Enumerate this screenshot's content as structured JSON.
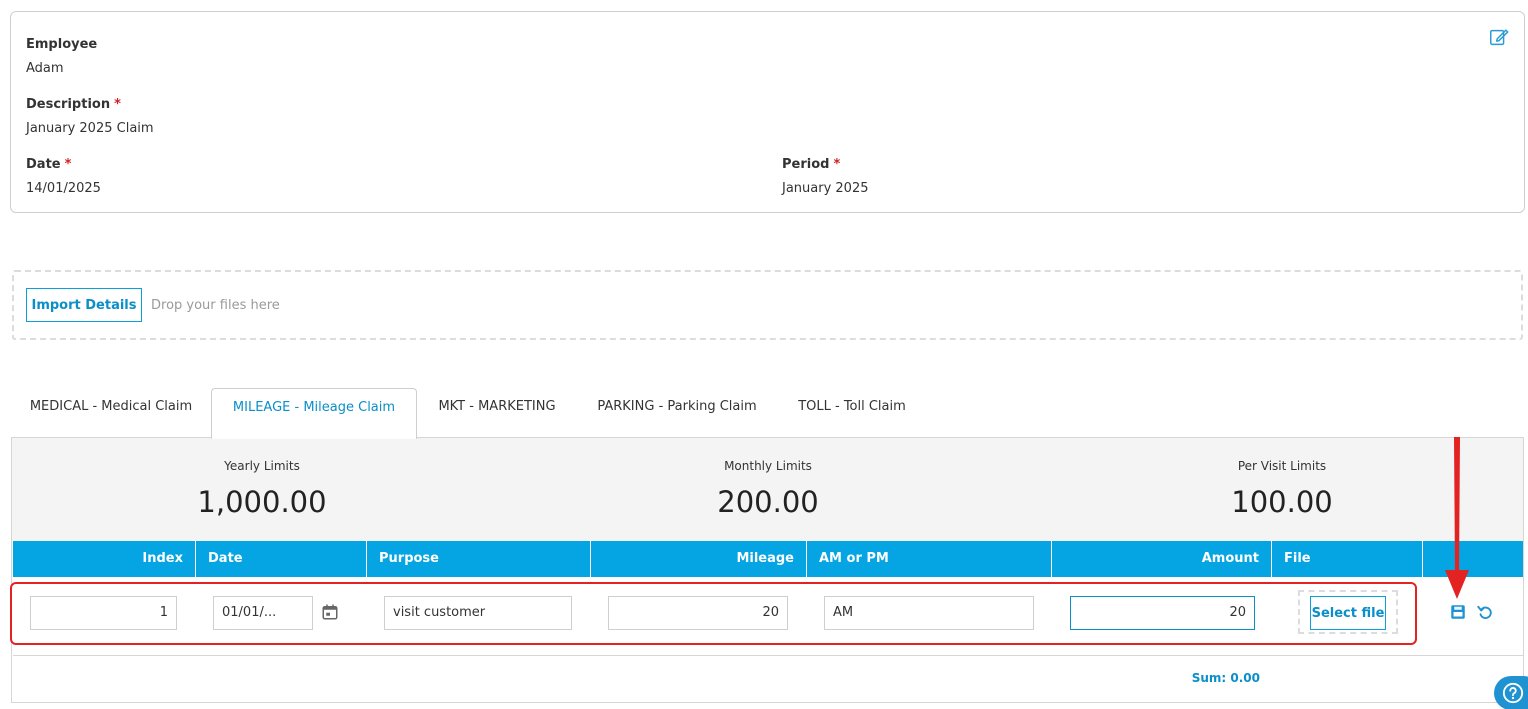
{
  "header": {
    "employee_label": "Employee",
    "employee_value": "Adam",
    "description_label": "Description",
    "description_value": "January 2025 Claim",
    "date_label": "Date",
    "date_value": "14/01/2025",
    "period_label": "Period",
    "period_value": "January 2025",
    "required_mark": "*"
  },
  "dropzone": {
    "import_label": "Import Details",
    "drop_text": "Drop your files here"
  },
  "tabs": [
    {
      "label": "MEDICAL - Medical Claim",
      "active": false
    },
    {
      "label": "MILEAGE - Mileage Claim",
      "active": true
    },
    {
      "label": "MKT - MARKETING",
      "active": false
    },
    {
      "label": "PARKING - Parking Claim",
      "active": false
    },
    {
      "label": "TOLL - Toll Claim",
      "active": false
    }
  ],
  "limits": {
    "yearly_label": "Yearly Limits",
    "yearly_value": "1,000.00",
    "monthly_label": "Monthly Limits",
    "monthly_value": "200.00",
    "per_visit_label": "Per Visit Limits",
    "per_visit_value": "100.00"
  },
  "table": {
    "columns": [
      "Index",
      "Date",
      "Purpose",
      "Mileage",
      "AM or PM",
      "Amount",
      "File"
    ],
    "row": {
      "index": "1",
      "date": "01/01/...",
      "purpose": "visit customer",
      "mileage": "20",
      "am_pm": "AM",
      "amount": "20",
      "select_file_label": "Select file"
    },
    "sum_text": "Sum: 0.00"
  },
  "colors": {
    "accent": "#05a4e3",
    "link": "#0a8fc8",
    "highlight": "#e32222",
    "required": "#d21f1f"
  },
  "icons": {
    "edit": "edit-icon",
    "calendar": "calendar-icon",
    "save": "save-icon",
    "undo": "undo-icon",
    "help": "help-icon"
  }
}
